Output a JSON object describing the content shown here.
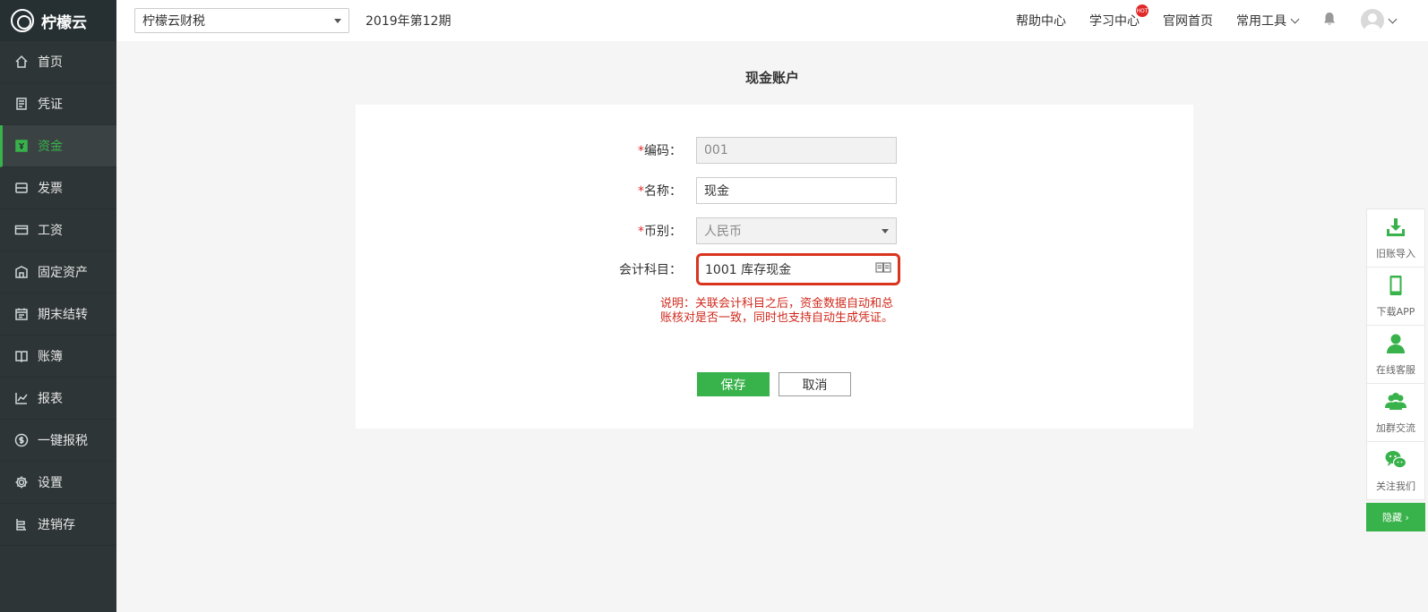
{
  "brand": {
    "name": "柠檬云"
  },
  "sidebar": {
    "items": [
      {
        "label": "首页",
        "icon": "home-icon"
      },
      {
        "label": "凭证",
        "icon": "voucher-icon"
      },
      {
        "label": "资金",
        "icon": "funds-icon",
        "active": true
      },
      {
        "label": "发票",
        "icon": "invoice-icon"
      },
      {
        "label": "工资",
        "icon": "salary-card-icon"
      },
      {
        "label": "固定资产",
        "icon": "building-icon"
      },
      {
        "label": "期末结转",
        "icon": "calendar-icon"
      },
      {
        "label": "账簿",
        "icon": "book-icon"
      },
      {
        "label": "报表",
        "icon": "chart-icon"
      },
      {
        "label": "一键报税",
        "icon": "dollar-icon"
      },
      {
        "label": "设置",
        "icon": "gear-icon"
      },
      {
        "label": "进销存",
        "icon": "inventory-icon"
      }
    ]
  },
  "header": {
    "company": "柠檬云财税",
    "period": "2019年第12期",
    "links": {
      "help": "帮助中心",
      "learn": "学习中心",
      "site": "官网首页",
      "tools": "常用工具"
    },
    "hot_badge": "HOT"
  },
  "page": {
    "title": "现金账户"
  },
  "form": {
    "code": {
      "label": "编码：",
      "value": "001",
      "required": "*"
    },
    "name": {
      "label": "名称：",
      "value": "现金",
      "required": "*"
    },
    "currency": {
      "label": "币别：",
      "value": "人民币",
      "required": "*"
    },
    "account": {
      "label": "会计科目：",
      "value": "1001 库存现金"
    },
    "note": "说明：关联会计科目之后，资金数据自动和总账核对是否一致，同时也支持自动生成凭证。",
    "save_label": "保存",
    "cancel_label": "取消"
  },
  "float_bar": {
    "items": [
      {
        "label": "旧账导入",
        "icon": "import-icon"
      },
      {
        "label": "下载APP",
        "icon": "phone-icon"
      },
      {
        "label": "在线客服",
        "icon": "person-icon"
      },
      {
        "label": "加群交流",
        "icon": "group-icon"
      },
      {
        "label": "关注我们",
        "icon": "wechat-icon"
      }
    ],
    "hide_label": "隐藏 ›"
  },
  "colors": {
    "accent": "#38b24a",
    "sidebar_bg": "#2e3537",
    "alert": "#d0291c"
  }
}
